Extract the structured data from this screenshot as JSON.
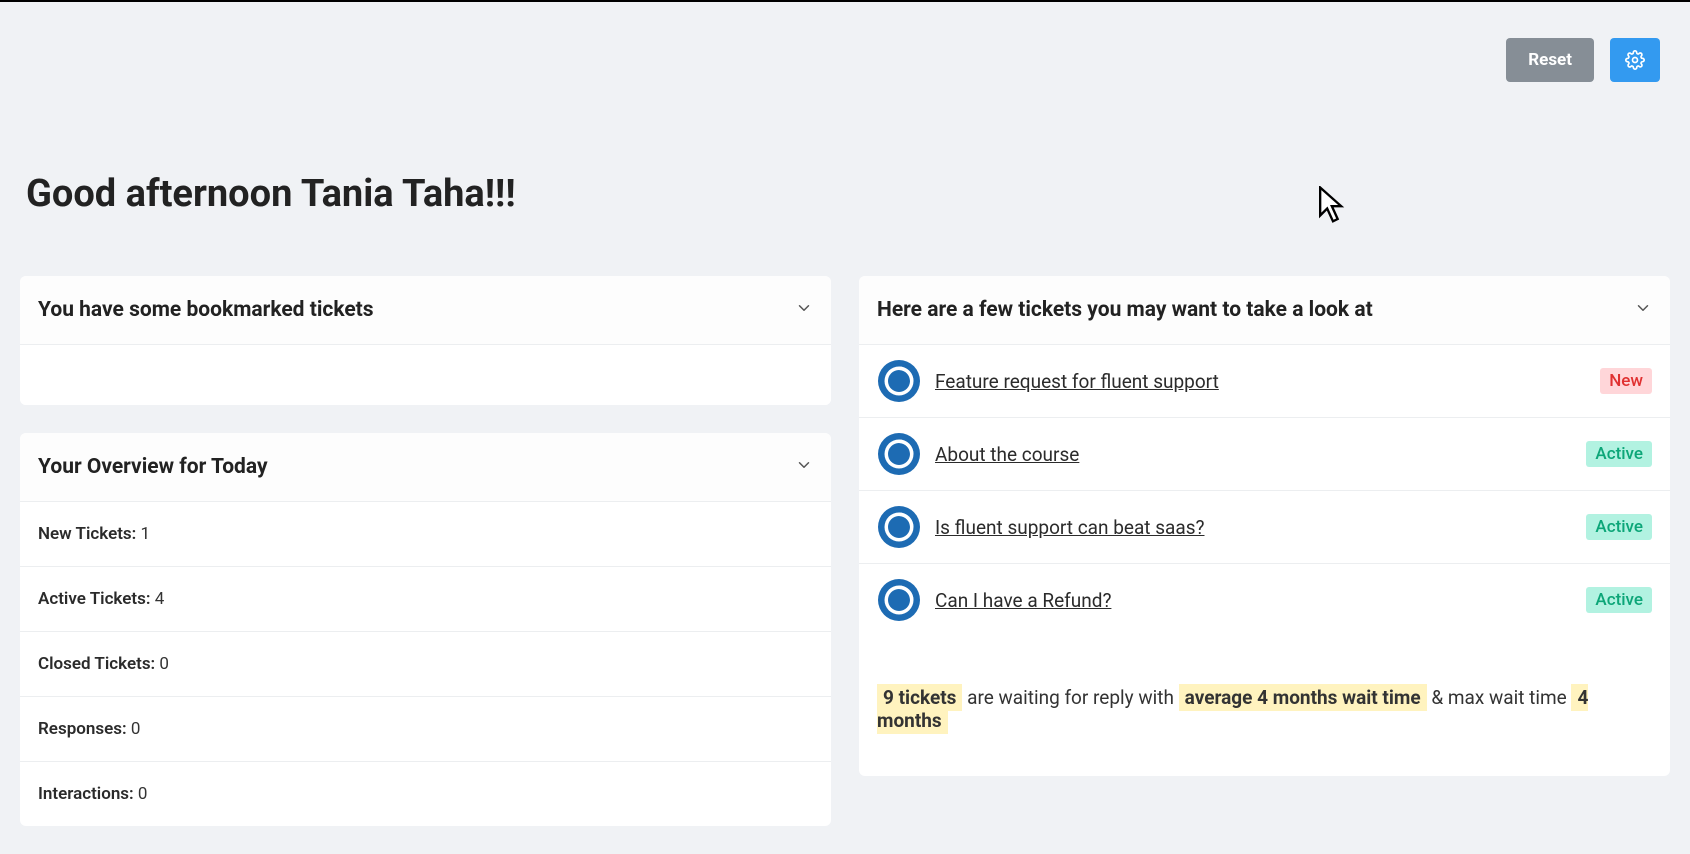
{
  "topbar": {
    "reset_label": "Reset"
  },
  "greeting": "Good afternoon Tania Taha!!!",
  "bookmarks": {
    "title": "You have some bookmarked tickets"
  },
  "overview": {
    "title": "Your Overview for Today",
    "rows": [
      {
        "label": "New Tickets:",
        "value": "1"
      },
      {
        "label": "Active Tickets:",
        "value": "4"
      },
      {
        "label": "Closed Tickets:",
        "value": "0"
      },
      {
        "label": "Responses:",
        "value": "0"
      },
      {
        "label": "Interactions:",
        "value": "0"
      }
    ]
  },
  "suggested": {
    "title": "Here are a few tickets you may want to take a look at",
    "tickets": [
      {
        "title": "Feature request for fluent support",
        "badge": "New",
        "badge_type": "new"
      },
      {
        "title": "About the course",
        "badge": "Active",
        "badge_type": "active"
      },
      {
        "title": "Is fluent support can beat saas?",
        "badge": "Active",
        "badge_type": "active"
      },
      {
        "title": "Can I have a Refund?",
        "badge": "Active",
        "badge_type": "active"
      }
    ],
    "summary": {
      "count": "9 tickets",
      "text1": " are waiting for reply with ",
      "avg": "average 4 months wait time",
      "text2": " & max wait time ",
      "max": "4 months"
    }
  }
}
